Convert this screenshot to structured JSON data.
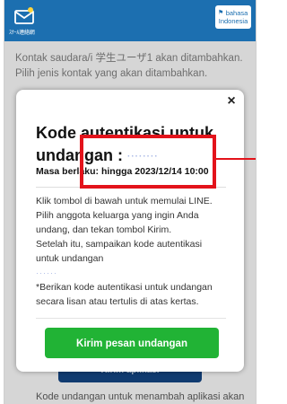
{
  "header": {
    "app_name": "ｽｸｰﾙ連絡網",
    "language_button": {
      "line1": "bahasa",
      "line2": "Indonesia"
    }
  },
  "background": {
    "intro_lines": [
      "Kontak saudara/i 学生ユーザ1 akan ditambahkan.",
      "Pilih jenis kontak yang akan ditambahkan."
    ],
    "button_label": "Kirim aplikasi",
    "footer_text": "Kode undangan untuk menambah aplikasi akan"
  },
  "modal": {
    "title_line1": "Kode autentikasi untuk",
    "title_line2": "undangan :",
    "title_code": "········",
    "expiry": "Masa berlaku: hingga 2023/12/14 10:00",
    "instructions": [
      "Klik tombol di bawah untuk memulai LINE.",
      "Pilih anggota keluarga yang ingin Anda",
      "undang, dan tekan tombol Kirim.",
      "Setelah itu, sampaikan kode autentikasi",
      "untuk undangan",
      "*Berikan kode autentikasi untuk undangan",
      "secara lisan atau tertulis di atas kertas."
    ],
    "inline_code": "······",
    "send_button_label": "Kirim pesan undangan",
    "close_label": "×"
  },
  "colors": {
    "header": "#1c6fb0",
    "send_button": "#21b335",
    "highlight": "#e3131b",
    "dark_button": "#12407a"
  }
}
